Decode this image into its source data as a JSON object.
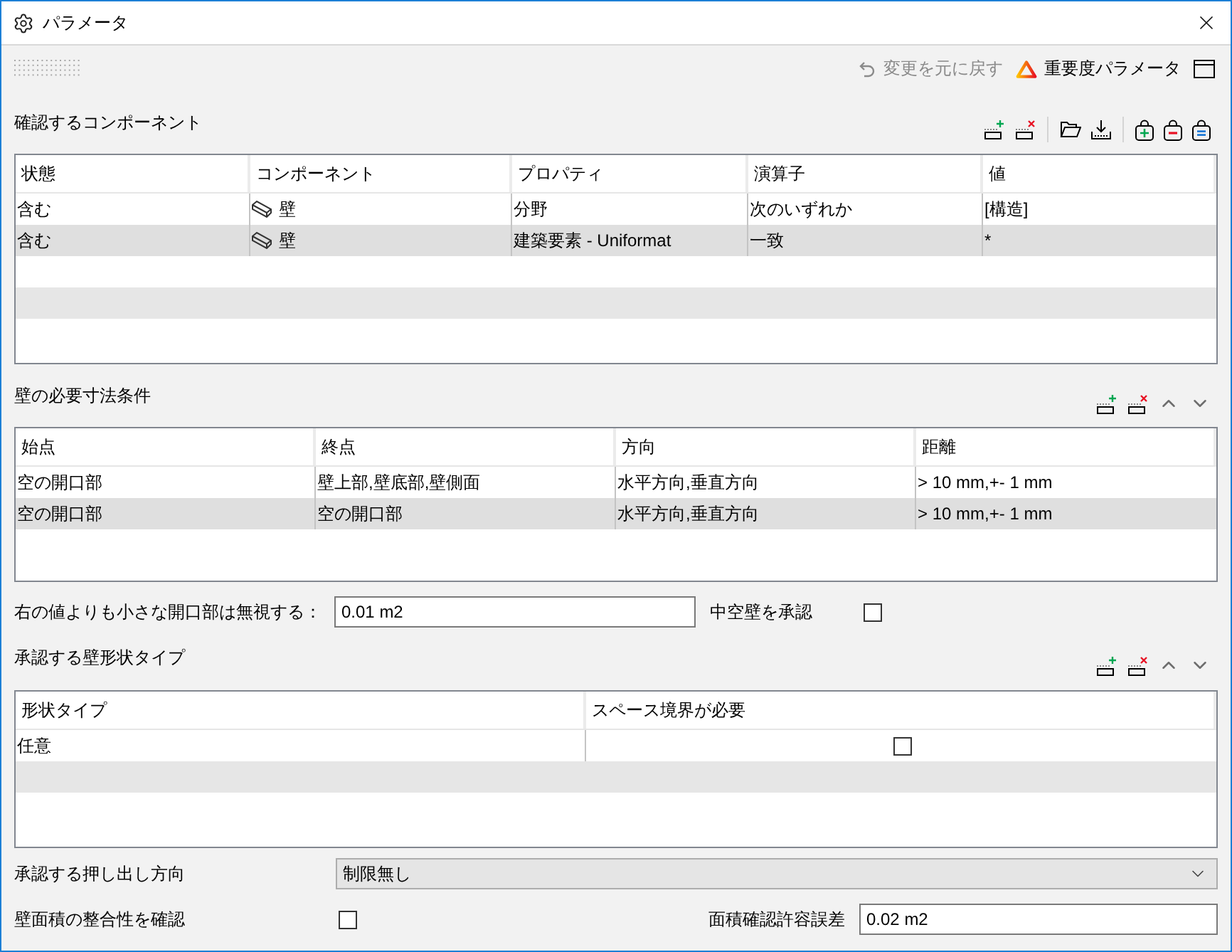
{
  "window": {
    "title": "パラメータ"
  },
  "toolbar": {
    "undo": {
      "label": "変更を元に戻す",
      "disabled": true
    },
    "severity": {
      "label": "重要度パラメータ"
    }
  },
  "components": {
    "title": "確認するコンポーネント",
    "columns": [
      "状態",
      "コンポーネント",
      "プロパティ",
      "演算子",
      "値"
    ],
    "rows": [
      {
        "state": "含む",
        "component": "壁",
        "property": "分野",
        "operator": "次のいずれか",
        "value": "[構造]"
      },
      {
        "state": "含む",
        "component": "壁",
        "property": "建築要素 - Uniformat",
        "operator": "一致",
        "value": "*"
      }
    ]
  },
  "dimensions": {
    "title": "壁の必要寸法条件",
    "columns": [
      "始点",
      "終点",
      "方向",
      "距離"
    ],
    "rows": [
      {
        "start": "空の開口部",
        "end": "壁上部,壁底部,壁側面",
        "direction": "水平方向,垂直方向",
        "distance": "> 10 mm,+- 1 mm"
      },
      {
        "start": "空の開口部",
        "end": "空の開口部",
        "direction": "水平方向,垂直方向",
        "distance": "> 10 mm,+- 1 mm"
      }
    ]
  },
  "ignore_openings": {
    "label": "右の値よりも小さな開口部は無視する：",
    "value": "0.01 m2"
  },
  "hollow_walls": {
    "label": "中空壁を承認",
    "checked": false
  },
  "shape_types": {
    "title": "承認する壁形状タイプ",
    "columns": [
      "形状タイプ",
      "スペース境界が必要"
    ],
    "rows": [
      {
        "type": "任意",
        "space_boundary_required": false
      }
    ]
  },
  "extrusion": {
    "label": "承認する押し出し方向",
    "value": "制限無し"
  },
  "area_check": {
    "label": "壁面積の整合性を確認",
    "checked": false
  },
  "area_tolerance": {
    "label": "面積確認許容誤差",
    "value": "0.02 m2"
  }
}
